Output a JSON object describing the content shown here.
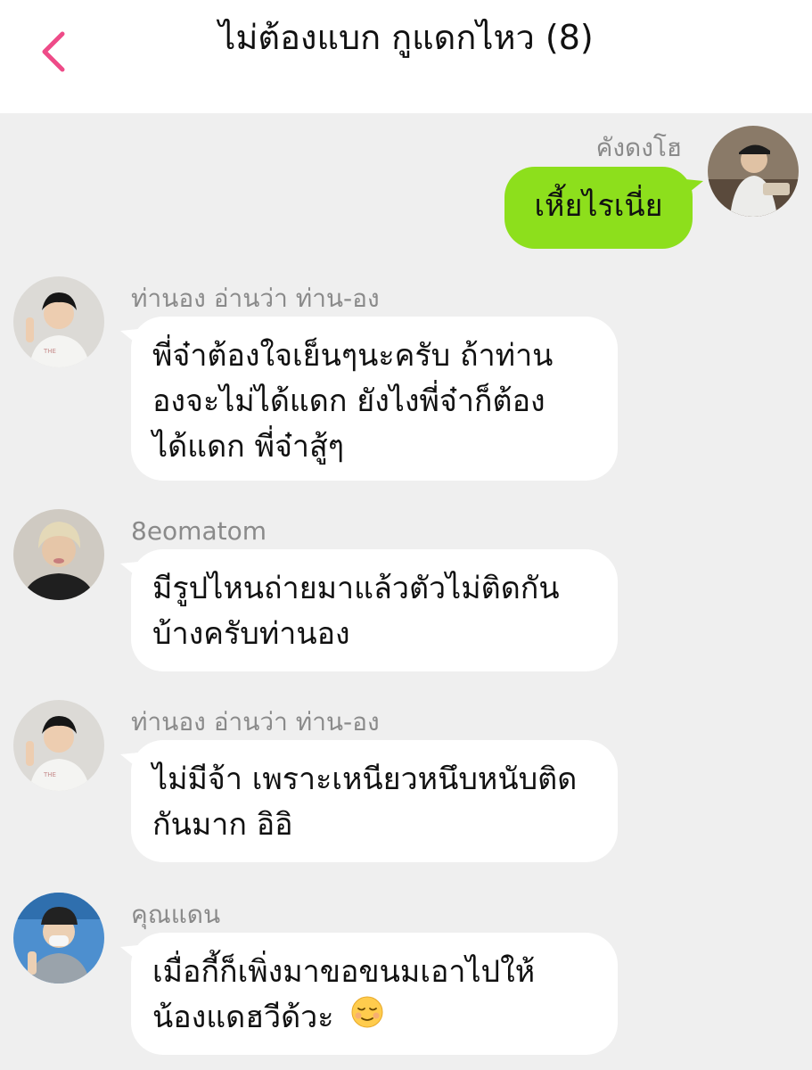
{
  "header": {
    "back_icon": "chevron-left-icon",
    "title": "ไม่ต้องแบก กูแดกไหว (8)"
  },
  "colors": {
    "accent": "#ee4b88",
    "outgoing_bubble": "#8ddf1c",
    "incoming_bubble": "#ffffff",
    "background": "#efefef"
  },
  "messages": [
    {
      "sender": "คังดงโฮ",
      "text": "เหี้ยไรเนี่ย",
      "outgoing": true
    },
    {
      "sender": "ท่านอง อ่านว่า ท่าน-อง",
      "lines": [
        "พี่จ๋าต้องใจเย็นๆนะครับ ถ้าท่าน",
        "องจะไม่ได้แดก ยังไงพี่จ๋าก็ต้อง",
        "ได้แดก พี่จ๋าสู้ๆ"
      ],
      "outgoing": false
    },
    {
      "sender": "8eomatom",
      "lines": [
        "มีรูปไหนถ่ายมาแล้วตัวไม่ติดกัน",
        "บ้างครับท่านอง"
      ],
      "outgoing": false
    },
    {
      "sender": "ท่านอง อ่านว่า ท่าน-อง",
      "lines": [
        "ไม่มีจ้า เพราะเหนียวหนึบหนับติด",
        "กันมาก อิอิ"
      ],
      "outgoing": false
    },
    {
      "sender": "คุณแดน",
      "lines": [
        "เมื่อกี้ก็เพิ่งมาขอขนมเอาไปให้",
        "น้องแดฮวีด้วะ"
      ],
      "emoji": "😌",
      "emoji_icon": "relieved-face-icon",
      "outgoing": false
    }
  ]
}
